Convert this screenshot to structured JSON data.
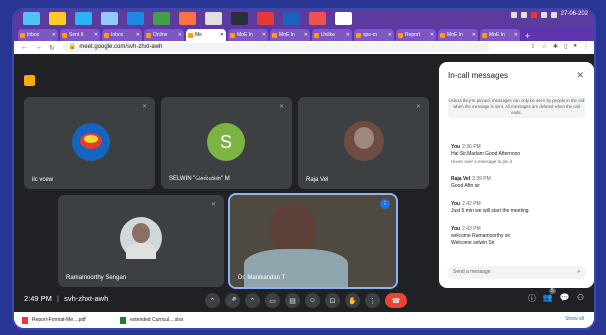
{
  "tabs": [
    {
      "label": "Inbox",
      "active": false
    },
    {
      "label": "Sent It",
      "active": false
    },
    {
      "label": "Inbox",
      "active": false
    },
    {
      "label": "Online",
      "active": false
    },
    {
      "label": "Me",
      "active": true
    },
    {
      "label": "MoE In",
      "active": false
    },
    {
      "label": "MoE In",
      "active": false
    },
    {
      "label": "Unlike",
      "active": false
    },
    {
      "label": "spe-m",
      "active": false
    },
    {
      "label": "Report",
      "active": false
    },
    {
      "label": "MoE In",
      "active": false
    },
    {
      "label": "MoE In",
      "active": false
    }
  ],
  "address": {
    "url": "meet.google.com/svh-zhxt-awh"
  },
  "clock": {
    "date": "27-06-202"
  },
  "participants": [
    {
      "name": "iic vcew"
    },
    {
      "name": "SELWIN \"செல்வின்\" M",
      "initial": "S"
    },
    {
      "name": "Raja Vel"
    },
    {
      "name": "Ramamoorthy Sengan"
    },
    {
      "name": "Dr. Manikandan T"
    }
  ],
  "chat": {
    "title": "In-call messages",
    "note": "Unless they're pinned, messages can only be seen by people in the call when the message is sent. All messages are deleted when the call ends.",
    "messages": [
      {
        "sender": "You",
        "time": "2:36 PM",
        "lines": [
          "Hai Sir,Madam Good Afternoon"
        ],
        "hint": "Hover over a message to pin it"
      },
      {
        "sender": "Raja Vel",
        "time": "2:39 PM",
        "lines": [
          "Good Aftn sir"
        ]
      },
      {
        "sender": "You",
        "time": "2:42 PM",
        "lines": [
          "Just 5 min we will start the meeting"
        ]
      },
      {
        "sender": "You",
        "time": "2:43 PM",
        "lines": [
          "welcome Ramamoorthy sir",
          "Welcome selwin Sir"
        ]
      }
    ],
    "send_placeholder": "Send a message"
  },
  "meeting": {
    "time": "2:49 PM",
    "code": "svh-zhxt-awh",
    "people_count": "5"
  },
  "downloads": [
    {
      "name": "Report-Format-Me....pdf"
    },
    {
      "name": "extended Curricul....xlsx"
    }
  ],
  "show_all": "Show all",
  "colors": {
    "end_call": "#ea4335",
    "speaking": "#8ab4f8",
    "taskbar": "#5c3b9e"
  }
}
